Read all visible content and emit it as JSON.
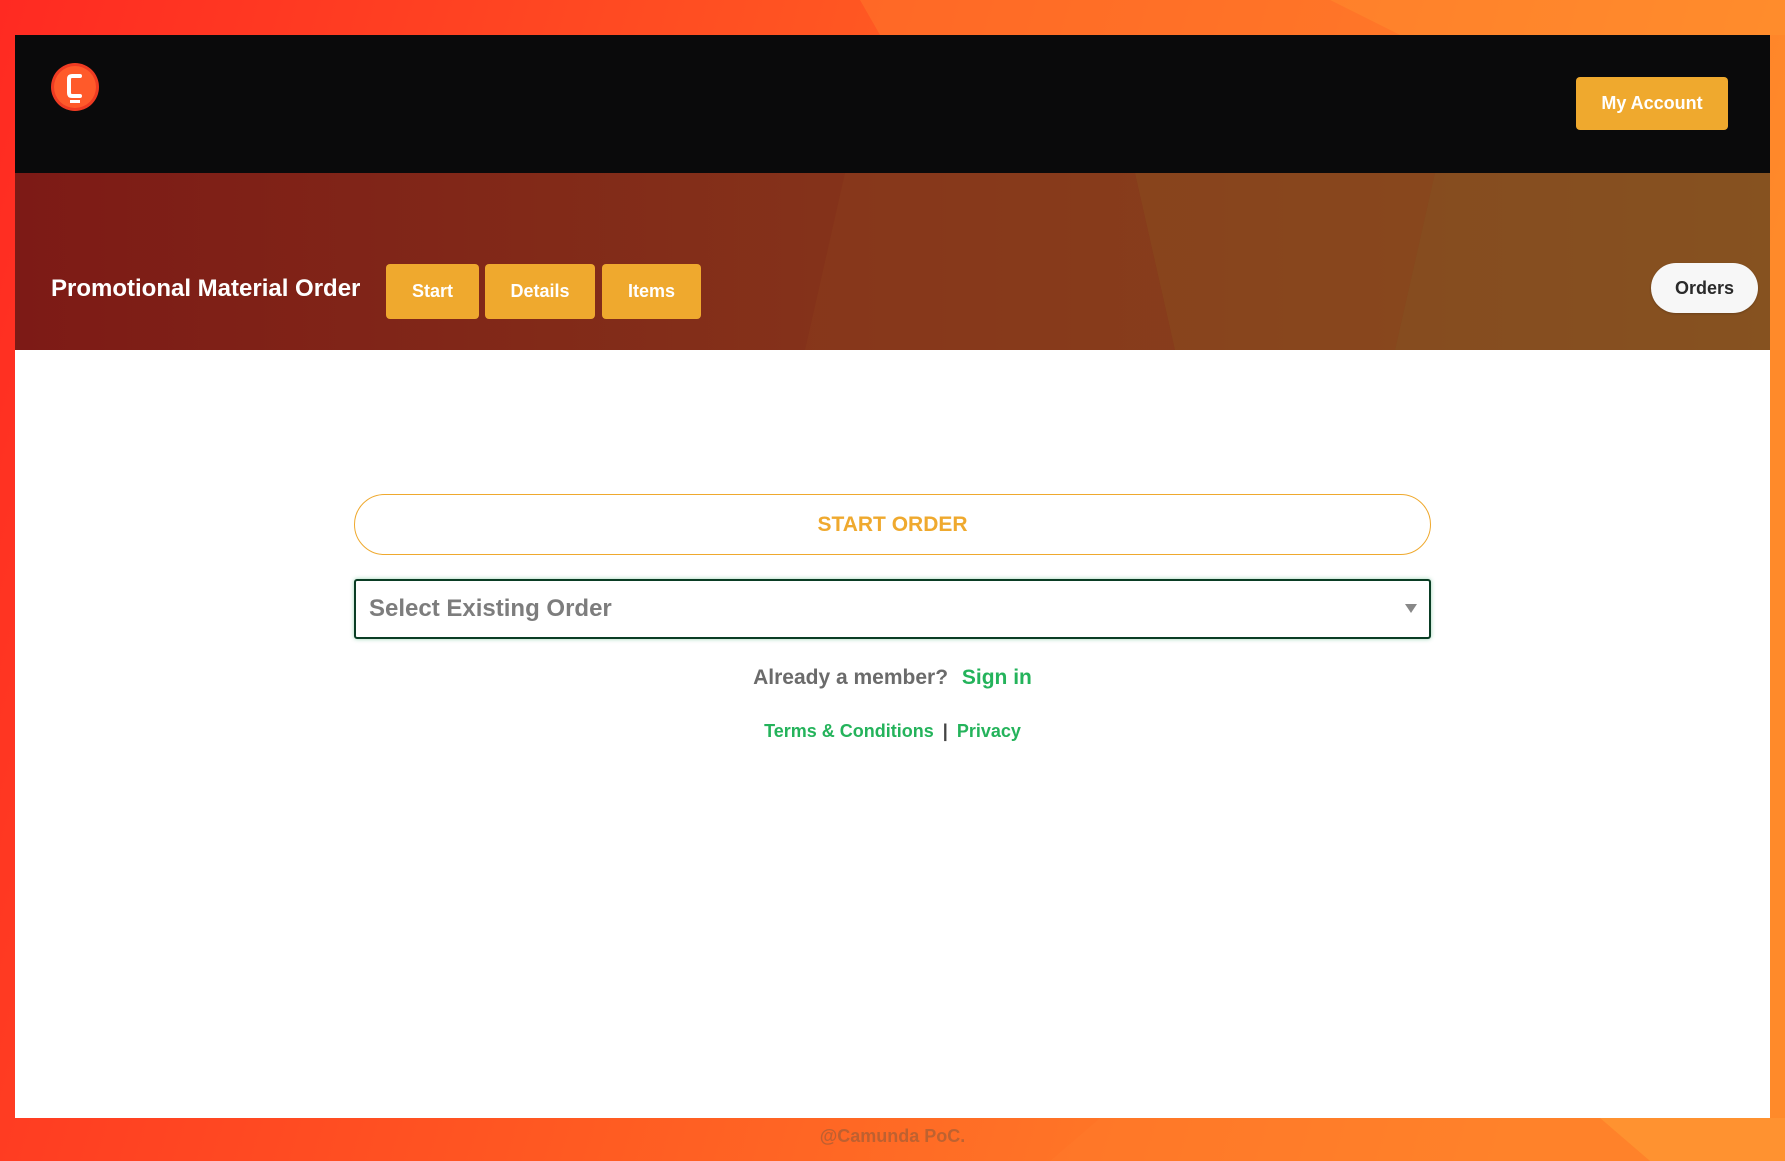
{
  "header": {
    "logo_letter": "C",
    "account_label": "My Account"
  },
  "banner": {
    "title": "Promotional Material Order",
    "tabs": [
      {
        "label": "Start"
      },
      {
        "label": "Details"
      },
      {
        "label": "Items"
      }
    ],
    "orders_label": "Orders"
  },
  "main": {
    "start_order_label": "START ORDER",
    "select": {
      "value": "Select Existing Order"
    },
    "member_prompt": "Already a member?",
    "sign_in_label": "Sign in",
    "terms_label": "Terms & Conditions",
    "separator": "|",
    "privacy_label": "Privacy"
  },
  "footer": {
    "copyright": "@Camunda PoC."
  },
  "colors": {
    "accent": "#efa92e",
    "link": "#24b35b",
    "topbar": "#0a0a0b",
    "logo": "#ef3b22"
  }
}
